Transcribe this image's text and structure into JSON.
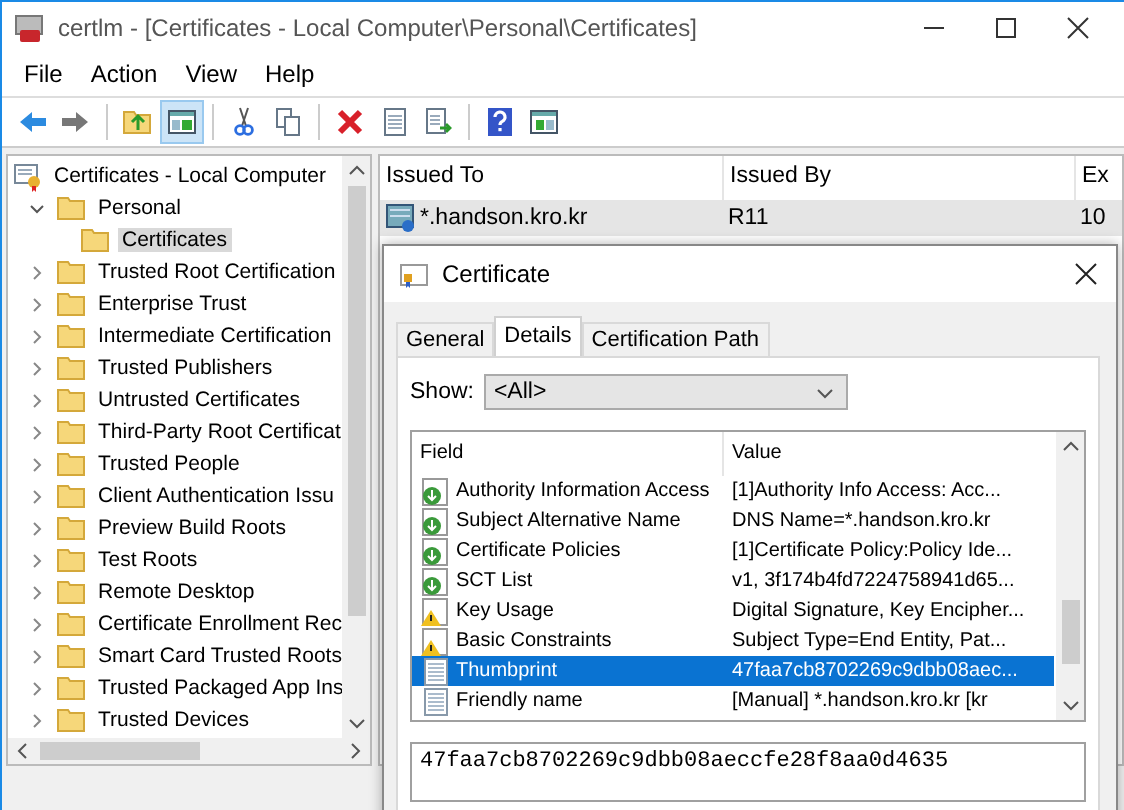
{
  "window": {
    "title": "certlm - [Certificates - Local Computer\\Personal\\Certificates]"
  },
  "menu": [
    "File",
    "Action",
    "View",
    "Help"
  ],
  "tree": {
    "label": "Certificates - Local Computer",
    "selected": false,
    "children": [
      {
        "label": "Personal",
        "expanded": true,
        "selected": false,
        "children": [
          {
            "label": "Certificates",
            "selected": true
          }
        ]
      },
      {
        "label": "Trusted Root Certification",
        "expanded": false,
        "selected": false
      },
      {
        "label": "Enterprise Trust",
        "expanded": false,
        "selected": false
      },
      {
        "label": "Intermediate Certification",
        "expanded": false,
        "selected": false
      },
      {
        "label": "Trusted Publishers",
        "expanded": false,
        "selected": false
      },
      {
        "label": "Untrusted Certificates",
        "expanded": false,
        "selected": false
      },
      {
        "label": "Third-Party Root Certificat",
        "expanded": false,
        "selected": false
      },
      {
        "label": "Trusted People",
        "expanded": false,
        "selected": false
      },
      {
        "label": "Client Authentication Issu",
        "expanded": false,
        "selected": false
      },
      {
        "label": "Preview Build Roots",
        "expanded": false,
        "selected": false
      },
      {
        "label": "Test Roots",
        "expanded": false,
        "selected": false
      },
      {
        "label": "Remote Desktop",
        "expanded": false,
        "selected": false
      },
      {
        "label": "Certificate Enrollment Rec",
        "expanded": false,
        "selected": false
      },
      {
        "label": "Smart Card Trusted Roots",
        "expanded": false,
        "selected": false
      },
      {
        "label": "Trusted Packaged App Ins",
        "expanded": false,
        "selected": false
      },
      {
        "label": "Trusted Devices",
        "expanded": false,
        "selected": false
      }
    ]
  },
  "list": {
    "columns": [
      "Issued To",
      "Issued By",
      "Ex"
    ],
    "rows": [
      {
        "cells": [
          "*.handson.kro.kr",
          "R11",
          "10"
        ],
        "selected": true
      }
    ]
  },
  "dialog": {
    "title": "Certificate",
    "tabs": [
      {
        "label": "General",
        "selected": false
      },
      {
        "label": "Details",
        "selected": true
      },
      {
        "label": "Certification Path",
        "selected": false
      }
    ],
    "show_label": "Show:",
    "show_value": "<All>",
    "fields": {
      "columns": [
        "Field",
        "Value"
      ],
      "rows": [
        {
          "kind": "extension",
          "field": "Authority Information Access",
          "value": "[1]Authority Info Access: Acc...",
          "selected": false
        },
        {
          "kind": "extension",
          "field": "Subject Alternative Name",
          "value": "DNS Name=*.handson.kro.kr",
          "selected": false
        },
        {
          "kind": "extension",
          "field": "Certificate Policies",
          "value": "[1]Certificate Policy:Policy Ide...",
          "selected": false
        },
        {
          "kind": "extension",
          "field": "SCT List",
          "value": "v1, 3f174b4fd7224758941d65...",
          "selected": false
        },
        {
          "kind": "critical",
          "field": "Key Usage",
          "value": "Digital Signature, Key Encipher...",
          "selected": false
        },
        {
          "kind": "critical",
          "field": "Basic Constraints",
          "value": "Subject Type=End Entity, Pat...",
          "selected": false
        },
        {
          "kind": "property",
          "field": "Thumbprint",
          "value": "47faa7cb8702269c9dbb08aec...",
          "selected": true
        },
        {
          "kind": "property",
          "field": "Friendly name",
          "value": "[Manual] *.handson.kro.kr [kr",
          "selected": false
        }
      ]
    },
    "detail_value": "47faa7cb8702269c9dbb08aeccfe28f8aa0d4635"
  }
}
